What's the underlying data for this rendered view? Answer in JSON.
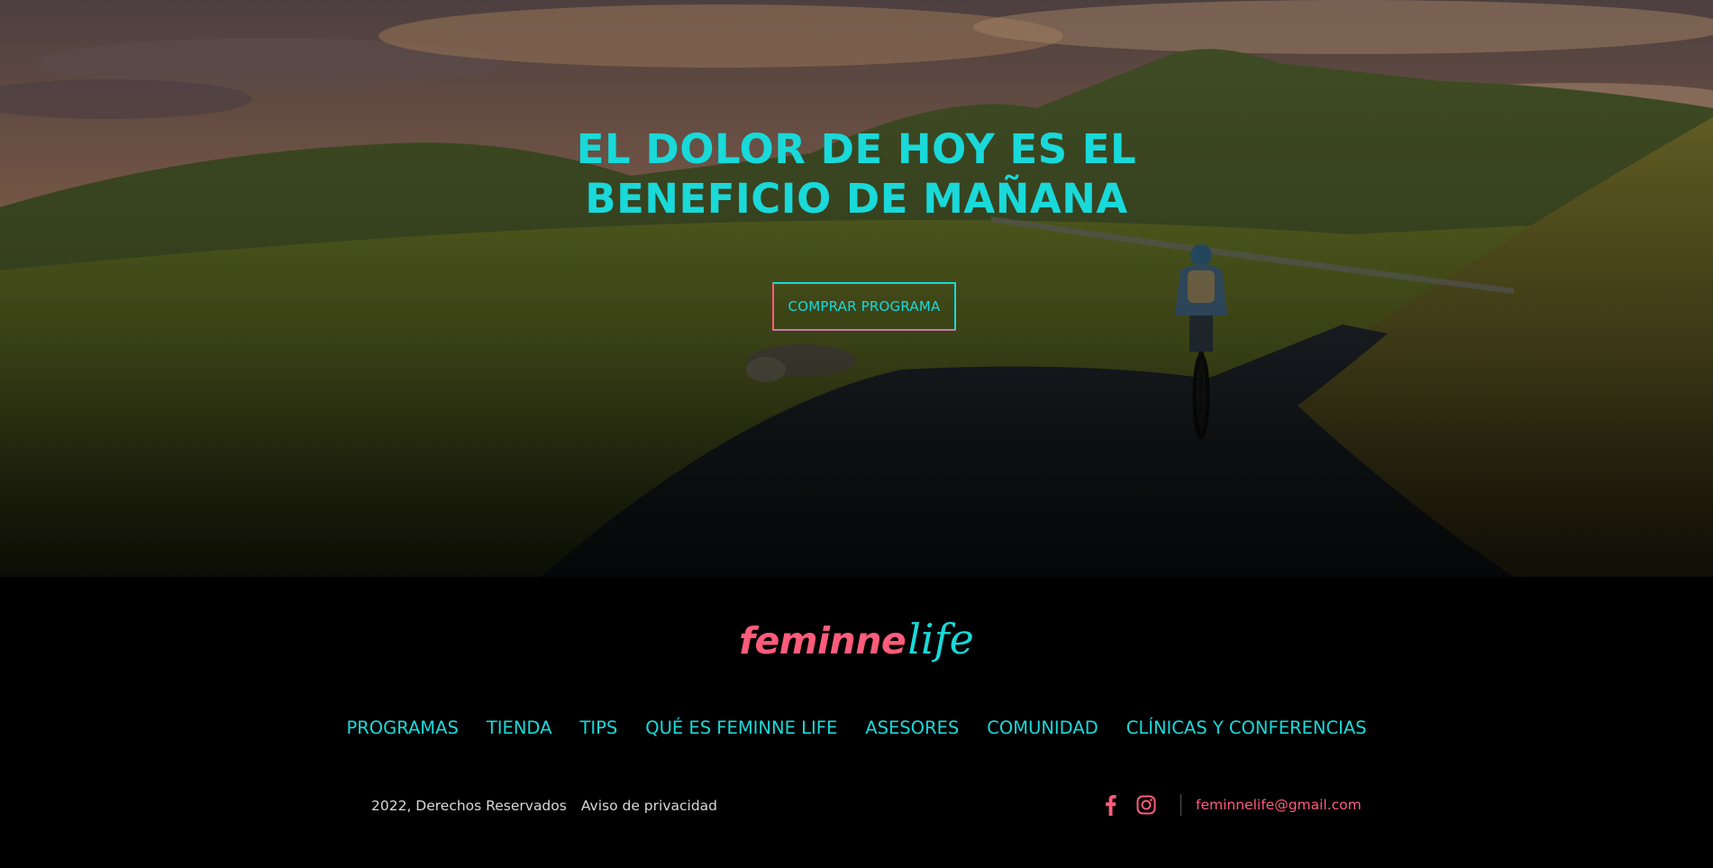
{
  "hero": {
    "title_line1": "EL DOLOR DE HOY ES EL",
    "title_line2": "BENEFICIO DE MAÑANA",
    "cta_label": "COMPRAR PROGRAMA",
    "background": "landscape-cyclist-photo"
  },
  "footer": {
    "logo_bold": "feminne",
    "logo_script": "life",
    "nav": [
      {
        "label": "PROGRAMAS"
      },
      {
        "label": "TIENDA"
      },
      {
        "label": "TIPS"
      },
      {
        "label": "QUÉ ES FEMINNE LIFE"
      },
      {
        "label": "ASESORES"
      },
      {
        "label": "COMUNIDAD"
      },
      {
        "label": "CLÍNICAS Y CONFERENCIAS"
      }
    ],
    "copyright": "2022, Derechos Reservados",
    "privacy": "Aviso de privacidad",
    "social": [
      {
        "name": "facebook-icon"
      },
      {
        "name": "instagram-icon"
      }
    ],
    "email": "feminnelife@gmail.com"
  },
  "colors": {
    "accent_cyan": "#19d9d9",
    "accent_pink": "#ff5c7a",
    "background": "#000000"
  }
}
